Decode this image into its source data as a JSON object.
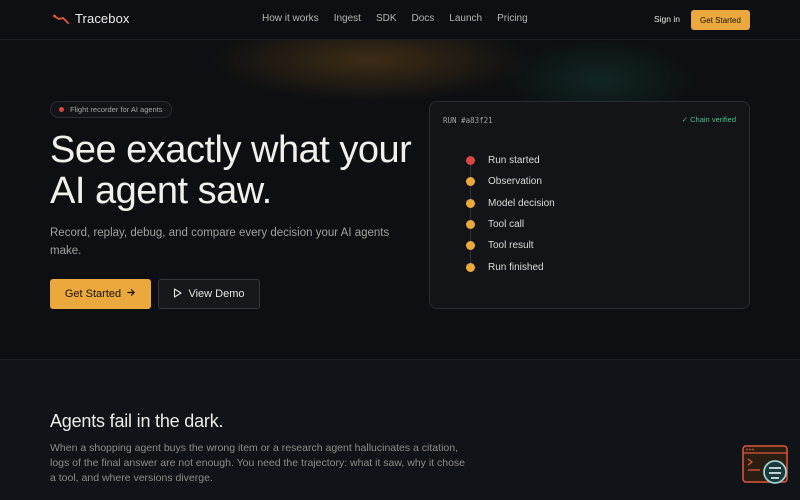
{
  "nav": {
    "brand": "Tracebox",
    "links": [
      "How it works",
      "Ingest",
      "SDK",
      "Docs",
      "Launch",
      "Pricing"
    ],
    "sign_in": "Sign in",
    "cta": "Get Started"
  },
  "hero": {
    "badge": "Flight recorder for AI agents",
    "title_line1": "See exactly what your",
    "title_line2": "AI agent saw.",
    "subtitle": "Record, replay, debug, and compare every decision your AI agents make.",
    "primary_cta": "Get Started",
    "secondary_cta": "View Demo"
  },
  "run_card": {
    "run_id": "RUN #a83f21",
    "status": "✓ Chain verified",
    "steps": [
      {
        "label": "Run started",
        "color": "#d9473e"
      },
      {
        "label": "Observation",
        "color": "#eba93d"
      },
      {
        "label": "Model decision",
        "color": "#eba93d"
      },
      {
        "label": "Tool call",
        "color": "#eba93d"
      },
      {
        "label": "Tool result",
        "color": "#eba93d"
      },
      {
        "label": "Run finished",
        "color": "#eba93d"
      }
    ]
  },
  "section2": {
    "heading": "Agents fail in the dark.",
    "body": "When a shopping agent buys the wrong item or a research agent hallucinates a citation, logs of the final answer are not enough. You need the trajectory: what it saw, why it chose a tool, and where versions diverge."
  },
  "colors": {
    "accent": "#eba93d",
    "danger": "#d9473e",
    "success": "#4fbf8a",
    "background": "#0d0f12"
  },
  "icons": {
    "logo": "tracebox-logo-icon",
    "arrow": "arrow-right-icon",
    "play": "play-icon",
    "widget": "terminal-chat-widget-icon"
  }
}
